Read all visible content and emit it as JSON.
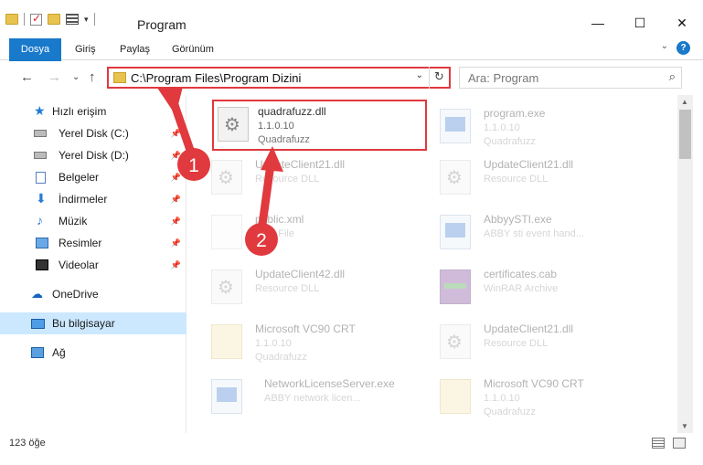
{
  "window": {
    "title": "Program",
    "controls": {
      "minimize": "—",
      "maximize": "☐",
      "close": "✕"
    }
  },
  "ribbon": {
    "tabs": [
      "Dosya",
      "Giriş",
      "Paylaş",
      "Görünüm"
    ],
    "help": "?",
    "expand": "⌄"
  },
  "nav": {
    "back": "←",
    "forward": "→",
    "recent": "⌄",
    "up": "↑",
    "address": "C:\\Program Files\\Program Dizini",
    "address_dropdown": "⌄",
    "refresh": "↻",
    "search_placeholder": "Ara: Program",
    "search_icon": "⌕"
  },
  "sidebar": {
    "quick_access": "Hızlı erişim",
    "items": [
      {
        "label": "Yerel Disk (C:)",
        "icon": "drive-icon",
        "pinned": true
      },
      {
        "label": "Yerel Disk (D:)",
        "icon": "drive-icon",
        "pinned": true
      },
      {
        "label": "Belgeler",
        "icon": "documents-icon",
        "pinned": true
      },
      {
        "label": "İndirmeler",
        "icon": "downloads-icon",
        "pinned": true
      },
      {
        "label": "Müzik",
        "icon": "music-icon",
        "pinned": true
      },
      {
        "label": "Resimler",
        "icon": "pictures-icon",
        "pinned": true
      },
      {
        "label": "Videolar",
        "icon": "videos-icon",
        "pinned": true
      }
    ],
    "onedrive": "OneDrive",
    "this_pc": "Bu bilgisayar",
    "network": "Ağ"
  },
  "files": [
    {
      "name": "quadrafuzz.dll",
      "line2": "1.1.0.10",
      "line3": "Quadrafuzz",
      "icon": "dll-icon"
    },
    {
      "name": "program.exe",
      "line2": "1.1.0.10",
      "line3": "Quadrafuzz",
      "icon": "exe-icon"
    },
    {
      "name": "UpdateClient21.dll",
      "line2": "Resource DLL",
      "line3": "",
      "icon": "dll-icon"
    },
    {
      "name": "UpdateClient21.dll",
      "line2": "Resource DLL",
      "line3": "",
      "icon": "dll-icon"
    },
    {
      "name": "public.xml",
      "line2": "XML File",
      "line3": "",
      "icon": "file-icon"
    },
    {
      "name": "AbbyySTI.exe",
      "line2": "ABBY sti event hand...",
      "line3": "",
      "icon": "exe-icon"
    },
    {
      "name": "UpdateClient42.dll",
      "line2": "Resource DLL",
      "line3": "",
      "icon": "dll-icon"
    },
    {
      "name": "certificates.cab",
      "line2": "WinRAR Archive",
      "line3": "",
      "icon": "archive-icon"
    },
    {
      "name": "Microsoft VC90 CRT",
      "line2": "1.1.0.10",
      "line3": "Quadrafuzz",
      "icon": "manifest-icon"
    },
    {
      "name": "UpdateClient21.dll",
      "line2": "Resource DLL",
      "line3": "",
      "icon": "dll-icon"
    },
    {
      "name": "NetworkLicenseServer.exe",
      "line2": "ABBY network licen...",
      "line3": "",
      "icon": "exe-icon"
    },
    {
      "name": "Microsoft VC90 CRT",
      "line2": "1.1.0.10",
      "line3": "Quadrafuzz",
      "icon": "manifest-icon"
    }
  ],
  "status": {
    "count": "123 öğe"
  },
  "annotations": {
    "marker1": "1",
    "marker2": "2",
    "color": "#e0393e"
  }
}
